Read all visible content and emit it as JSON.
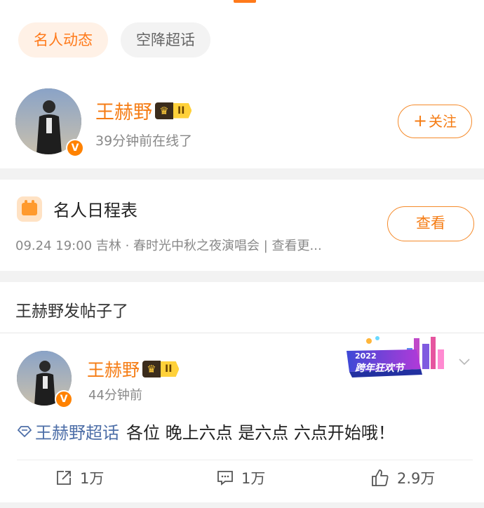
{
  "tabs": [
    {
      "label": "名人动态",
      "active": true
    },
    {
      "label": "空降超话",
      "active": false
    }
  ],
  "profile": {
    "name": "王赫野",
    "level": "II",
    "status": "39分钟前在线了",
    "follow_label": "关注"
  },
  "schedule": {
    "title": "名人日程表",
    "detail": "09.24 19:00 吉林 · 春时光中秋之夜演唱会 |  查看更...",
    "view_label": "查看"
  },
  "post_section": {
    "header": "王赫野发帖子了"
  },
  "post": {
    "author": "王赫野",
    "level": "II",
    "time": "44分钟前",
    "topic": "王赫野超话",
    "text": "各位 晚上六点 是六点 六点开始哦！",
    "banner_year": "2022",
    "banner_text": "跨年狂欢节",
    "reposts": "1万",
    "comments": "1万",
    "likes": "2.9万"
  },
  "colors": {
    "accent": "#f57c14",
    "topic": "#4e6fa8",
    "divider": "#f2f2f2"
  },
  "icons": {
    "verified": "v-badge-icon",
    "crown": "crown-icon",
    "schedule": "calendar-icon",
    "repost": "share-icon",
    "comment": "comment-icon",
    "like": "thumbs-up-icon",
    "more": "chevron-down-icon"
  }
}
